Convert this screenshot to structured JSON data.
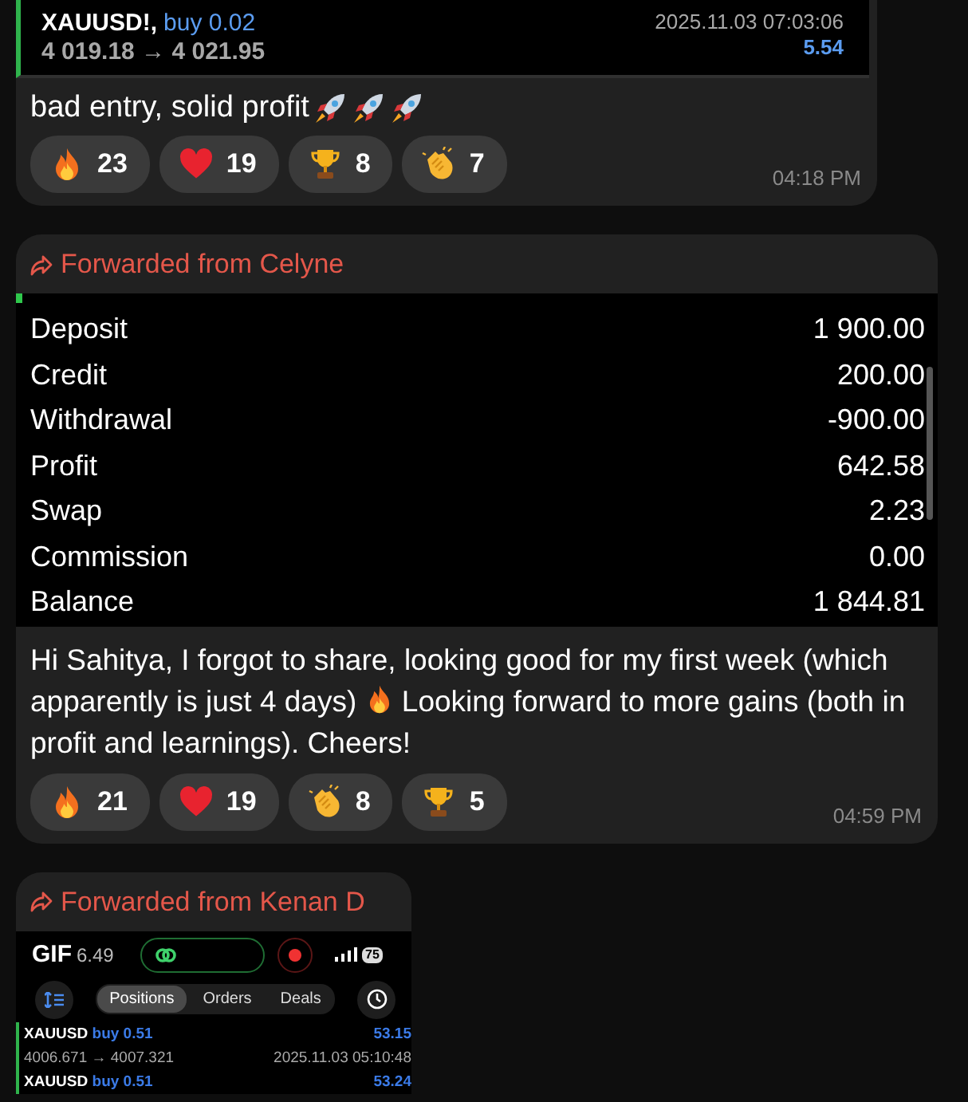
{
  "messages": [
    {
      "kind": "trade",
      "trade": {
        "symbol": "XAUUSD!,",
        "side": "buy 0.02",
        "prices": "4 019.18 → 4 021.95",
        "time": "2025.11.03 07:03:06",
        "profit": "5.54"
      },
      "text": "bad entry, solid profit",
      "reactions": [
        {
          "kind": "fire",
          "count": "23"
        },
        {
          "kind": "heart",
          "count": "19"
        },
        {
          "kind": "trophy",
          "count": "8"
        },
        {
          "kind": "clap",
          "count": "7"
        }
      ],
      "time": "04:18 PM"
    },
    {
      "kind": "report",
      "forwarded": "Forwarded from Celyne",
      "rows": [
        {
          "label": "Deposit",
          "value": "1 900.00"
        },
        {
          "label": "Credit",
          "value": "200.00"
        },
        {
          "label": "Withdrawal",
          "value": "-900.00"
        },
        {
          "label": "Profit",
          "value": "642.58"
        },
        {
          "label": "Swap",
          "value": "2.23"
        },
        {
          "label": "Commission",
          "value": "0.00"
        },
        {
          "label": "Balance",
          "value": "1 844.81"
        }
      ],
      "text": "Hi Sahitya, I forgot to share, looking good for my first week (which apparently is just 4 days)",
      "text_after": "Looking forward to more gains (both in profit and learnings). Cheers!",
      "reactions": [
        {
          "kind": "fire",
          "count": "21"
        },
        {
          "kind": "heart",
          "count": "19"
        },
        {
          "kind": "clap",
          "count": "8"
        },
        {
          "kind": "trophy",
          "count": "5"
        }
      ],
      "time": "04:59 PM"
    },
    {
      "kind": "screenshot",
      "forwarded": "Forwarded from Kenan D",
      "screenshot": {
        "status_label": "GIF",
        "clock": "6.49",
        "battery": "75",
        "tabs": [
          {
            "label": "Positions",
            "selected": true
          },
          {
            "label": "Orders",
            "selected": false
          },
          {
            "label": "Deals",
            "selected": false
          }
        ],
        "positions": [
          {
            "symbol": "XAUUSD",
            "side": "buy 0.51",
            "profit": "53.15",
            "prices": "4006.671 → 4007.321",
            "time": "2025.11.03 05:10:48"
          },
          {
            "symbol": "XAUUSD",
            "side": "buy 0.51",
            "profit": "53.24"
          }
        ]
      }
    }
  ]
}
